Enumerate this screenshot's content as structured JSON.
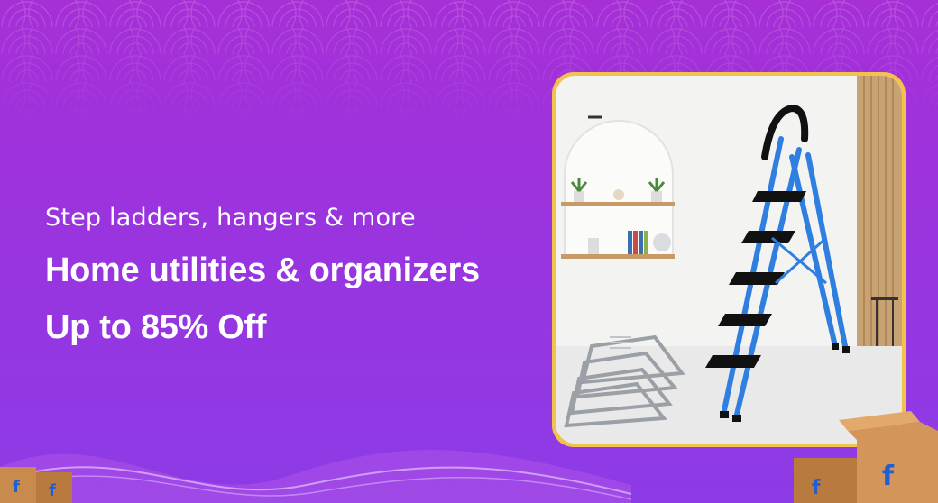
{
  "banner": {
    "subtitle": "Step ladders, hangers & more",
    "headline": "Home utilities & organizers",
    "offer": "Up to 85% Off"
  },
  "colors": {
    "background_top": "#a62fd6",
    "background_bottom": "#8c3be6",
    "card_border": "#f2c24e",
    "ladder_blue": "#2f7fe0",
    "box_brown": "#c98a4e",
    "flipkart_blue": "#1f5fd6"
  },
  "icons": {
    "brand_box": "flipkart-box-icon"
  }
}
